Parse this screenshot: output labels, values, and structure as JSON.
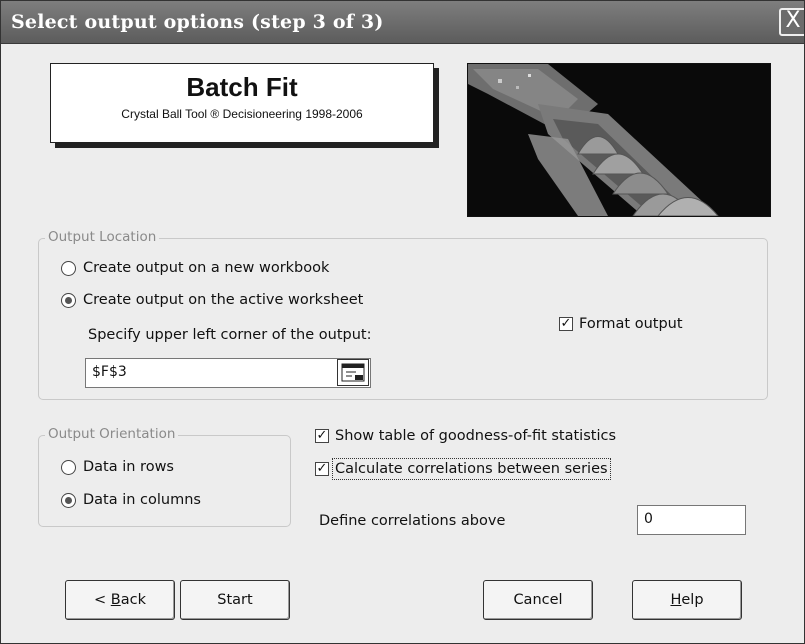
{
  "window": {
    "title": "Select output options (step 3 of 3)",
    "close_glyph": "X"
  },
  "logo": {
    "title": "Batch Fit",
    "subtitle": "Crystal Ball Tool ® Decisioneering 1998-2006"
  },
  "output_location": {
    "legend": "Output Location",
    "new_workbook_label": "Create output on a new workbook",
    "active_worksheet_label": "Create output on the active worksheet",
    "selected": "active_worksheet",
    "corner_prompt": "Specify upper left corner of the output:",
    "corner_value": "$F$3",
    "format_output_label": "Format output",
    "format_output_checked": true
  },
  "output_orientation": {
    "legend": "Output Orientation",
    "rows_label": "Data in rows",
    "columns_label": "Data in columns",
    "selected": "columns"
  },
  "options": {
    "gof_label": "Show table of goodness-of-fit statistics",
    "gof_checked": true,
    "corr_label": "Calculate correlations between series",
    "corr_checked": true,
    "corr_threshold_label": "Define correlations above",
    "corr_threshold_value": "0"
  },
  "buttons": {
    "back_prefix": "< ",
    "back_mnemonic": "B",
    "back_rest": "ack",
    "start": "Start",
    "cancel": "Cancel",
    "help_mnemonic": "H",
    "help_rest": "elp"
  },
  "icons": {
    "close": "close-icon",
    "picker": "range-picker-icon",
    "check": "checkmark-icon"
  },
  "colors": {
    "titlebar": "#6b6b6b",
    "window_bg": "#ededed",
    "group_border": "#c9c9c9"
  }
}
